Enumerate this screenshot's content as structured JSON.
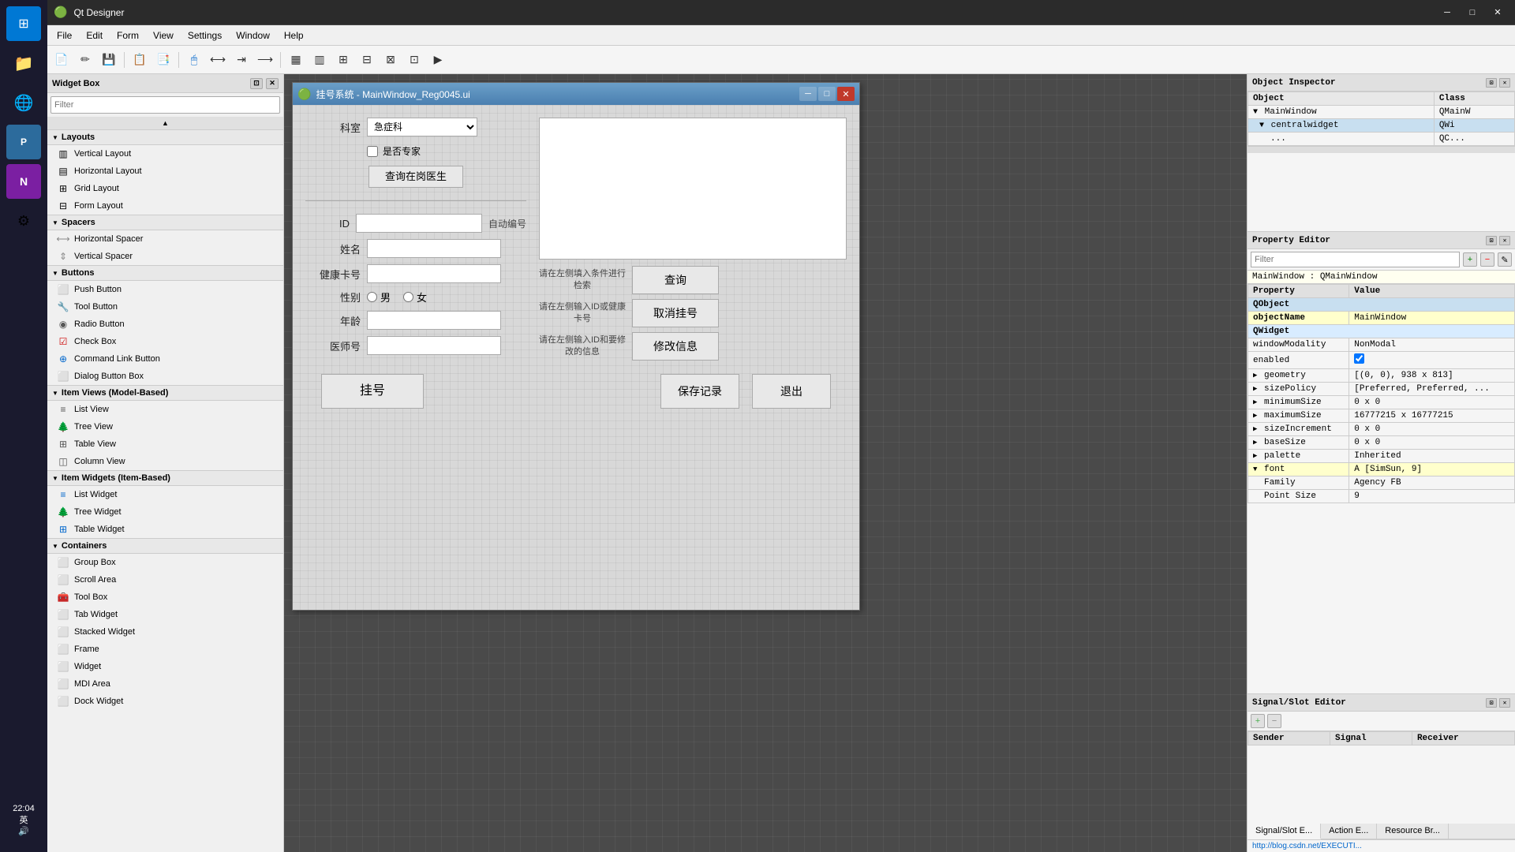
{
  "app": {
    "title": "Qt Designer",
    "icon": "Qt"
  },
  "taskbar": {
    "items": [
      {
        "icon": "⊞",
        "name": "start"
      },
      {
        "icon": "📁",
        "name": "file-manager"
      },
      {
        "icon": "🌐",
        "name": "browser"
      },
      {
        "icon": "💎",
        "name": "ide"
      },
      {
        "icon": "N",
        "name": "onenote"
      },
      {
        "icon": "⚙",
        "name": "settings"
      }
    ],
    "time": "22:04",
    "lang": "英"
  },
  "qt_title_bar": {
    "title": "Qt Designer",
    "icon": "Qt",
    "minimize": "─",
    "maximize": "□",
    "close": "✕"
  },
  "menu": {
    "items": [
      "File",
      "Edit",
      "Form",
      "View",
      "Settings",
      "Window",
      "Help"
    ]
  },
  "toolbar": {
    "buttons": [
      "📄",
      "✏",
      "💾",
      "📋",
      "📑",
      "🔧",
      "↩",
      "⬛",
      "≡",
      "⊞",
      "↔",
      "↕",
      "⊕"
    ]
  },
  "widget_box": {
    "title": "Widget Box",
    "filter_placeholder": "Filter",
    "sections": [
      {
        "name": "Layouts",
        "items": [
          {
            "icon": "▥",
            "label": "Vertical Layout"
          },
          {
            "icon": "▤",
            "label": "Horizontal Layout"
          },
          {
            "icon": "⊞",
            "label": "Grid Layout"
          },
          {
            "icon": "⊟",
            "label": "Form Layout"
          }
        ]
      },
      {
        "name": "Spacers",
        "items": [
          {
            "icon": "↔",
            "label": "Horizontal Spacer"
          },
          {
            "icon": "↕",
            "label": "Vertical Spacer"
          }
        ]
      },
      {
        "name": "Buttons",
        "items": [
          {
            "icon": "⬜",
            "label": "Push Button"
          },
          {
            "icon": "🔧",
            "label": "Tool Button"
          },
          {
            "icon": "◉",
            "label": "Radio Button"
          },
          {
            "icon": "☑",
            "label": "Check Box"
          },
          {
            "icon": "⊕",
            "label": "Command Link Button"
          },
          {
            "icon": "⬜",
            "label": "Dialog Button Box"
          }
        ]
      },
      {
        "name": "Item Views (Model-Based)",
        "items": [
          {
            "icon": "≡",
            "label": "List View"
          },
          {
            "icon": "🌲",
            "label": "Tree View"
          },
          {
            "icon": "⊞",
            "label": "Table View"
          },
          {
            "icon": "◫",
            "label": "Column View"
          }
        ]
      },
      {
        "name": "Item Widgets (Item-Based)",
        "items": [
          {
            "icon": "≡",
            "label": "List Widget"
          },
          {
            "icon": "🌲",
            "label": "Tree Widget"
          },
          {
            "icon": "⊞",
            "label": "Table Widget"
          }
        ]
      },
      {
        "name": "Containers",
        "items": [
          {
            "icon": "⬜",
            "label": "Group Box"
          },
          {
            "icon": "⬜",
            "label": "Scroll Area"
          },
          {
            "icon": "🧰",
            "label": "Tool Box"
          },
          {
            "icon": "⬜",
            "label": "Tab Widget"
          },
          {
            "icon": "⬜",
            "label": "Stacked Widget"
          },
          {
            "icon": "⬜",
            "label": "Frame"
          },
          {
            "icon": "⬜",
            "label": "Widget"
          },
          {
            "icon": "⬜",
            "label": "MDI Area"
          },
          {
            "icon": "⬜",
            "label": "Dock Widget"
          }
        ]
      }
    ]
  },
  "form_window": {
    "title": "挂号系统 - MainWindow_Reg0045.ui",
    "icon": "Qt",
    "department_label": "科室",
    "department_value": "急症科",
    "specialist_label": "是否专家",
    "query_btn": "查询在岗医生",
    "id_label": "ID",
    "auto_label": "自动编号",
    "name_label": "姓名",
    "health_card_label": "健康卡号",
    "gender_label": "性别",
    "gender_male": "男",
    "gender_female": "女",
    "age_label": "年龄",
    "doctor_id_label": "医师号",
    "search_hint1": "请在左侧填入条件进行检索",
    "search_btn": "查询",
    "cancel_hint": "请在左侧输入ID或健康卡号",
    "cancel_btn": "取消挂号",
    "modify_hint": "请在左侧输入ID和要修改的信息",
    "modify_btn": "修改信息",
    "register_btn": "挂号",
    "save_btn": "保存记录",
    "exit_btn": "退出"
  },
  "object_inspector": {
    "title": "Object Inspector",
    "columns": [
      "Object",
      "Class"
    ],
    "rows": [
      {
        "indent": 0,
        "arrow": "▼",
        "name": "MainWindow",
        "class": "QMainW",
        "selected": false
      },
      {
        "indent": 1,
        "arrow": "▼",
        "name": "centralwidget",
        "class": "QWi",
        "selected": false
      },
      {
        "indent": 2,
        "arrow": "",
        "name": "...",
        "class": "QC...",
        "selected": false
      }
    ]
  },
  "property_editor": {
    "title": "Property Editor",
    "filter_placeholder": "Filter",
    "context": "MainWindow : QMainWindow",
    "columns": [
      "Property",
      "Value"
    ],
    "sections": [
      {
        "name": "QObject",
        "properties": [
          {
            "name": "objectName",
            "value": "MainWindow",
            "highlight": true
          }
        ]
      },
      {
        "name": "QWidget",
        "properties": [
          {
            "name": "windowModality",
            "value": "NonModal"
          },
          {
            "name": "enabled",
            "value": "✓",
            "is_check": true
          },
          {
            "name": "geometry",
            "value": "[(0, 0), 938 x 813]",
            "expandable": true
          },
          {
            "name": "sizePolicy",
            "value": "[Preferred, Preferred, ...",
            "expandable": true
          },
          {
            "name": "minimumSize",
            "value": "0 x 0",
            "expandable": true
          },
          {
            "name": "maximumSize",
            "value": "16777215 x 16777215",
            "expandable": true
          },
          {
            "name": "sizeIncrement",
            "value": "0 x 0",
            "expandable": true
          },
          {
            "name": "baseSize",
            "value": "0 x 0",
            "expandable": true
          },
          {
            "name": "palette",
            "value": "Inherited",
            "expandable": true
          },
          {
            "name": "font",
            "value": "A [SimSun, 9]",
            "expandable": true,
            "highlight": true
          },
          {
            "name": "Family",
            "value": "Agency FB",
            "indent": true
          },
          {
            "name": "Point Size",
            "value": "9",
            "indent": true
          }
        ]
      }
    ]
  },
  "signal_slot_editor": {
    "title": "Signal/Slot Editor",
    "tabs": [
      "Signal/Slot E...",
      "Action E...",
      "Resource Br..."
    ],
    "active_tab": "Signal/Slot E...",
    "columns": [
      "Sender",
      "Signal",
      "Receiver"
    ],
    "url": "http://blog.csdn.net/EXECUTI...",
    "add_btn": "+",
    "remove_btn": "−"
  }
}
